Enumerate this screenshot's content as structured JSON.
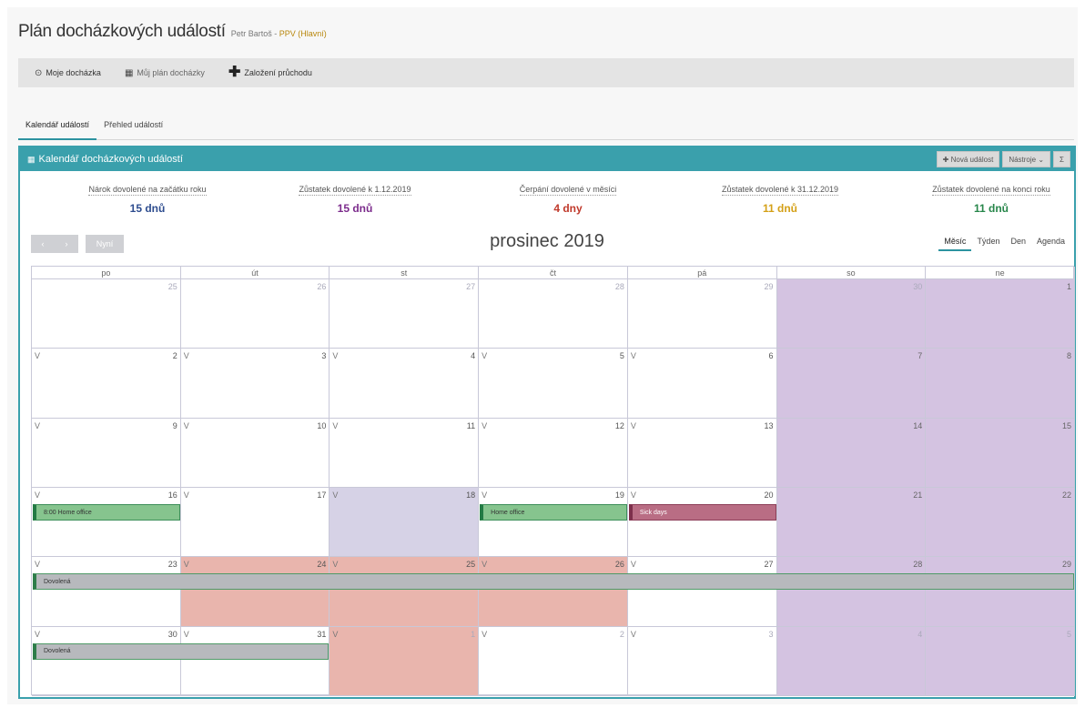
{
  "header": {
    "title": "Plán docházkových událostí",
    "user": "Petr Bartoš - ",
    "branch": "PPV (Hlavní)"
  },
  "toolbar": {
    "my_attendance": "Moje docházka",
    "my_plan": "Můj plán docházky",
    "create_pass": "Založení průchodu"
  },
  "tabs": {
    "calendar": "Kalendář událostí",
    "overview": "Přehled událostí"
  },
  "panel": {
    "title": "Kalendář docházkových událostí",
    "new_event": "Nová událost",
    "tools": "Nástroje",
    "sum": "Σ"
  },
  "stats": [
    {
      "label": "Nárok dovolené na začátku roku",
      "value": "15 dnů",
      "color": "#2e4d8f"
    },
    {
      "label": "Zůstatek dovolené k 1.12.2019",
      "value": "15 dnů",
      "color": "#7c2c8c"
    },
    {
      "label": "Čerpání dovolené v měsíci",
      "value": "4 dny",
      "color": "#c0392b"
    },
    {
      "label": "Zůstatek dovolené k 31.12.2019",
      "value": "11 dnů",
      "color": "#d4a017"
    },
    {
      "label": "Zůstatek dovolené na konci roku",
      "value": "11 dnů",
      "color": "#27864a"
    }
  ],
  "nav": {
    "prev": "‹",
    "next": "›",
    "today": "Nyní",
    "month_title": "prosinec 2019",
    "views": [
      "Měsíc",
      "Týden",
      "Den",
      "Agenda"
    ]
  },
  "calendar": {
    "weekdays": [
      "po",
      "út",
      "st",
      "čt",
      "pá",
      "so",
      "ne"
    ],
    "weeks": [
      [
        {
          "d": "25",
          "o": true
        },
        {
          "d": "26",
          "o": true
        },
        {
          "d": "27",
          "o": true
        },
        {
          "d": "28",
          "o": true
        },
        {
          "d": "29",
          "o": true
        },
        {
          "d": "30",
          "o": true
        },
        {
          "d": "1"
        }
      ],
      [
        {
          "d": "2",
          "m": "V"
        },
        {
          "d": "3",
          "m": "V"
        },
        {
          "d": "4",
          "m": "V"
        },
        {
          "d": "5",
          "m": "V"
        },
        {
          "d": "6",
          "m": "V"
        },
        {
          "d": "7"
        },
        {
          "d": "8"
        }
      ],
      [
        {
          "d": "9",
          "m": "V"
        },
        {
          "d": "10",
          "m": "V"
        },
        {
          "d": "11",
          "m": "V"
        },
        {
          "d": "12",
          "m": "V"
        },
        {
          "d": "13",
          "m": "V"
        },
        {
          "d": "14"
        },
        {
          "d": "15"
        }
      ],
      [
        {
          "d": "16",
          "m": "V"
        },
        {
          "d": "17",
          "m": "V"
        },
        {
          "d": "18",
          "m": "V",
          "hl": true
        },
        {
          "d": "19",
          "m": "V"
        },
        {
          "d": "20",
          "m": "V"
        },
        {
          "d": "21"
        },
        {
          "d": "22"
        }
      ],
      [
        {
          "d": "23",
          "m": "V"
        },
        {
          "d": "24",
          "m": "V",
          "hol": true
        },
        {
          "d": "25",
          "m": "V",
          "hol": true
        },
        {
          "d": "26",
          "m": "V",
          "hol": true
        },
        {
          "d": "27",
          "m": "V"
        },
        {
          "d": "28"
        },
        {
          "d": "29"
        }
      ],
      [
        {
          "d": "30",
          "m": "V"
        },
        {
          "d": "31",
          "m": "V"
        },
        {
          "d": "1",
          "m": "V",
          "o": true,
          "hol": true
        },
        {
          "d": "2",
          "m": "V",
          "o": true
        },
        {
          "d": "3",
          "m": "V",
          "o": true
        },
        {
          "d": "4",
          "o": true
        },
        {
          "d": "5",
          "o": true
        }
      ]
    ],
    "events": [
      {
        "text": "8:00 Home office",
        "week": 3,
        "start": 0,
        "span": 1,
        "style": "ev-green"
      },
      {
        "text": "Home office",
        "week": 3,
        "start": 3,
        "span": 1,
        "style": "ev-green"
      },
      {
        "text": "Sick days",
        "week": 3,
        "start": 4,
        "span": 1,
        "style": "ev-red"
      },
      {
        "text": "Dovolená",
        "week": 4,
        "start": 0,
        "span": 7,
        "style": "ev-gray"
      },
      {
        "text": "Dovolená",
        "week": 5,
        "start": 0,
        "span": 2,
        "style": "ev-gray"
      }
    ]
  }
}
